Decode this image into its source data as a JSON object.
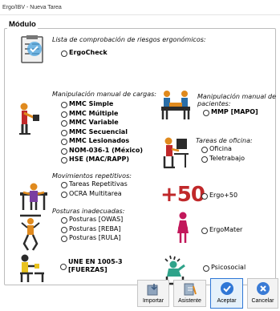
{
  "window": {
    "title": "Ergo/IBV - Nueva Tarea"
  },
  "module_section": {
    "legend": "Módulo"
  },
  "groups": {
    "checklist": {
      "title": "Lista de comprobación de riesgos ergonómicos:",
      "options": [
        "ErgoCheck"
      ]
    },
    "manual_handling": {
      "title": "Manipulación manual de cargas:",
      "options": [
        "MMC Simple",
        "MMC Múltiple",
        "MMC Variable",
        "MMC Secuencial",
        "MMC Lesionados",
        "NOM-036-1 (México)",
        "HSE (MAC/RAPP)"
      ]
    },
    "patients": {
      "title_line1": "Manipulación manual de",
      "title_line2": "pacientes:",
      "options": [
        "MMP [MAPO]"
      ]
    },
    "office": {
      "title": "Tareas de oficina:",
      "options": [
        "Oficina",
        "Teletrabajo"
      ]
    },
    "repetitive": {
      "title": "Movimientos repetitivos:",
      "options": [
        "Tareas Repetitivas",
        "OCRA Multitarea"
      ]
    },
    "ergo50": {
      "big_label": "+50",
      "options": [
        "Ergo+50"
      ]
    },
    "postures": {
      "title": "Posturas inadecuadas:",
      "options": [
        "Posturas [OWAS]",
        "Posturas [REBA]",
        "Posturas [RULA]"
      ]
    },
    "ergomater": {
      "options": [
        "ErgoMater"
      ]
    },
    "une": {
      "options_line1": "UNE EN 1005-3",
      "options_line2": "[FUERZAS]"
    },
    "psicosocial": {
      "options": [
        "Psicosocial"
      ]
    }
  },
  "buttons": {
    "importar": "Importar",
    "asistente": "Asistente",
    "aceptar": "Aceptar",
    "cancelar": "Cancelar"
  },
  "colors": {
    "accent_blue": "#2f77d6",
    "cancel_blue": "#3a7bd5",
    "ergo_red": "#c0282a",
    "figure_orange": "#e08a1e",
    "figure_dark": "#2b2b2b"
  }
}
